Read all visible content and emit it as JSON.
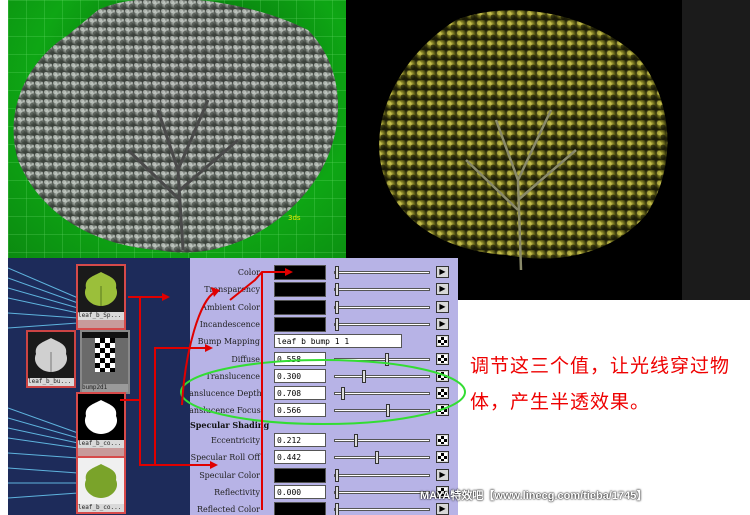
{
  "viewport": {
    "label": "3ds"
  },
  "hypershade": {
    "nodes": [
      {
        "caption": "leaf_b_Sp..."
      },
      {
        "caption": "leaf_b_bu..."
      },
      {
        "caption": "bump2d1"
      },
      {
        "caption": "leaf_b_co..."
      },
      {
        "caption": "leaf_b_co..."
      }
    ]
  },
  "attributes": {
    "rows": [
      {
        "label": "Color",
        "kind": "color"
      },
      {
        "label": "Transparency",
        "kind": "color"
      },
      {
        "label": "Ambient Color",
        "kind": "color"
      },
      {
        "label": "Incandescence",
        "kind": "color"
      },
      {
        "label": "Bump Mapping",
        "kind": "text",
        "value": "leaf b bump 1 1"
      },
      {
        "label": "Diffuse",
        "kind": "number",
        "value": "0.558",
        "slider": 0.558
      },
      {
        "label": "Translucence",
        "kind": "number",
        "value": "0.300",
        "slider": 0.3
      },
      {
        "label": "Translucence Depth",
        "kind": "number",
        "value": "0.708",
        "slider": 0.071
      },
      {
        "label": "Translucence Focus",
        "kind": "number",
        "value": "0.566",
        "slider": 0.566
      }
    ],
    "section_title": "Specular Shading",
    "spec_rows": [
      {
        "label": "Eccentricity",
        "kind": "number",
        "value": "0.212",
        "slider": 0.212
      },
      {
        "label": "Specular Roll Off",
        "kind": "number",
        "value": "0.442",
        "slider": 0.442
      },
      {
        "label": "Specular Color",
        "kind": "color"
      },
      {
        "label": "Reflectivity",
        "kind": "number",
        "value": "0.000",
        "slider": 0.0
      },
      {
        "label": "Reflected Color",
        "kind": "color"
      }
    ]
  },
  "annotation": {
    "text": "调节这三个值，让光线穿过物体，产生半透效果。"
  },
  "watermark": {
    "text": "MAYA特效吧【www.linecg.com/tieba/1745】"
  },
  "colors": {
    "panel_bg": "#b7b3e6",
    "annotation_red": "#e00000",
    "highlight_green": "#33dd33",
    "arrow_red": "#e00000"
  }
}
